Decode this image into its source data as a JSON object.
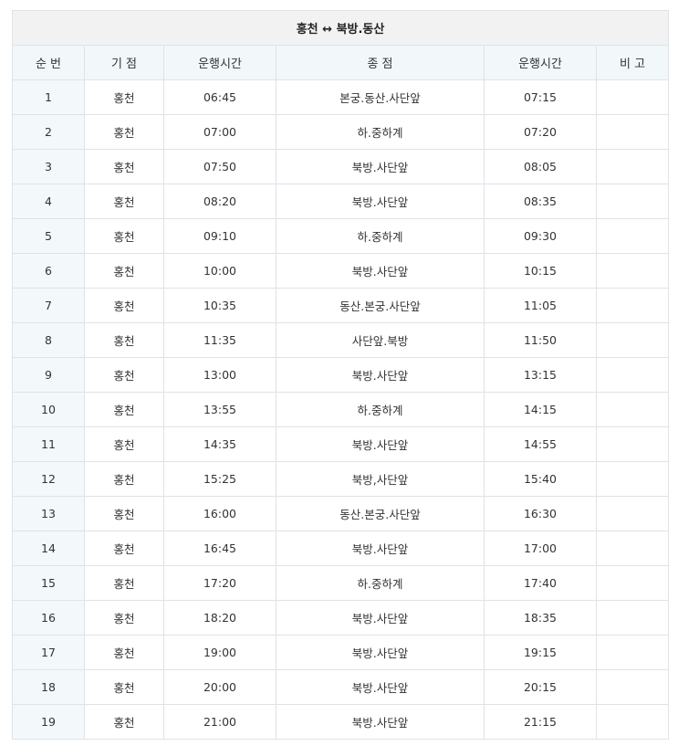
{
  "title": "홍천 ↔ 북방.동산",
  "columns": [
    "순 번",
    "기 점",
    "운행시간",
    "종 점",
    "운행시간",
    "비 고"
  ],
  "rows": [
    [
      "1",
      "홍천",
      "06:45",
      "본궁.동산.사단앞",
      "07:15",
      ""
    ],
    [
      "2",
      "홍천",
      "07:00",
      "하.중하계",
      "07:20",
      ""
    ],
    [
      "3",
      "홍천",
      "07:50",
      "북방.사단앞",
      "08:05",
      ""
    ],
    [
      "4",
      "홍천",
      "08:20",
      "북방.사단앞",
      "08:35",
      ""
    ],
    [
      "5",
      "홍천",
      "09:10",
      "하.중하계",
      "09:30",
      ""
    ],
    [
      "6",
      "홍천",
      "10:00",
      "북방.사단앞",
      "10:15",
      ""
    ],
    [
      "7",
      "홍천",
      "10:35",
      "동산.본궁.사단앞",
      "11:05",
      ""
    ],
    [
      "8",
      "홍천",
      "11:35",
      "사단앞.북방",
      "11:50",
      ""
    ],
    [
      "9",
      "홍천",
      "13:00",
      "북방.사단앞",
      "13:15",
      ""
    ],
    [
      "10",
      "홍천",
      "13:55",
      "하.중하계",
      "14:15",
      ""
    ],
    [
      "11",
      "홍천",
      "14:35",
      "북방.사단앞",
      "14:55",
      ""
    ],
    [
      "12",
      "홍천",
      "15:25",
      "북방,사단앞",
      "15:40",
      ""
    ],
    [
      "13",
      "홍천",
      "16:00",
      "동산.본궁.사단앞",
      "16:30",
      ""
    ],
    [
      "14",
      "홍천",
      "16:45",
      "북방.사단앞",
      "17:00",
      ""
    ],
    [
      "15",
      "홍천",
      "17:20",
      "하.중하계",
      "17:40",
      ""
    ],
    [
      "16",
      "홍천",
      "18:20",
      "북방.사단앞",
      "18:35",
      ""
    ],
    [
      "17",
      "홍천",
      "19:00",
      "북방.사단앞",
      "19:15",
      ""
    ],
    [
      "18",
      "홍천",
      "20:00",
      "북방.사단앞",
      "20:15",
      ""
    ],
    [
      "19",
      "홍천",
      "21:00",
      "북방.사단앞",
      "21:15",
      ""
    ]
  ]
}
